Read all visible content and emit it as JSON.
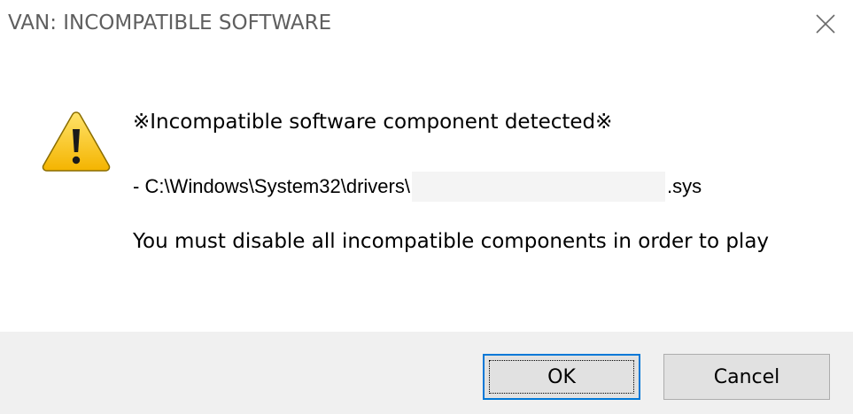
{
  "window": {
    "title": "VAN: INCOMPATIBLE SOFTWARE",
    "close_icon": "close-icon"
  },
  "message": {
    "icon": "warning-icon",
    "heading": "※Incompatible software component detected※",
    "path_prefix": "- C:\\Windows\\System32\\drivers\\",
    "path_suffix": ".sys",
    "body": "You must disable all incompatible components in order to play"
  },
  "buttons": {
    "ok_label": "OK",
    "cancel_label": "Cancel"
  },
  "colors": {
    "footer_bg": "#f0f0f0",
    "focus_accent": "#0078d7",
    "warning_yellow": "#fcd116"
  }
}
